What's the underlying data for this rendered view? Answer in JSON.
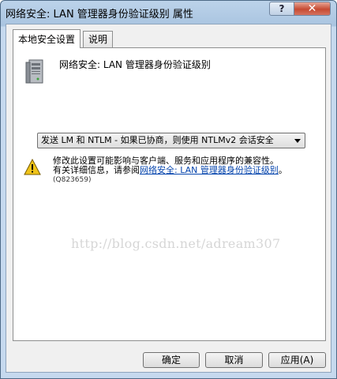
{
  "window": {
    "title": "网络安全: LAN 管理器身份验证级别 属性"
  },
  "titlebar_buttons": {
    "help": "?",
    "close": "✕"
  },
  "tabs": [
    {
      "label": "本地安全设置",
      "active": true
    },
    {
      "label": "说明",
      "active": false
    }
  ],
  "policy": {
    "title": "网络安全: LAN 管理器身份验证级别"
  },
  "dropdown": {
    "selected": "发送 LM 和 NTLM - 如果已协商，则使用 NTLMv2 会话安全"
  },
  "warning": {
    "line1": "修改此设置可能影响与客户端、服务和应用程序的兼容性。",
    "line2_prefix": "有关详细信息，请参阅",
    "link": "网络安全: LAN 管理器身份验证级别",
    "line2_suffix": "。",
    "kb": "(Q823659)"
  },
  "watermark": "http://blog.csdn.net/adream307",
  "buttons": {
    "ok": "确定",
    "cancel": "取消",
    "apply": "应用(A)"
  },
  "colors": {
    "title_bar": "#bcd3ea",
    "close_button": "#c64a32",
    "link": "#0645ad",
    "warning": "#f0c419"
  },
  "icons": {
    "policy": "server-icon",
    "warning": "warning-icon"
  }
}
